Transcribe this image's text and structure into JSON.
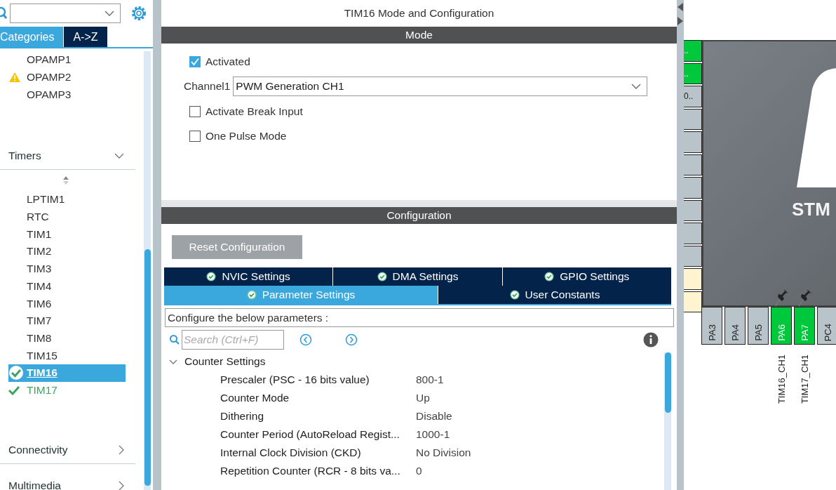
{
  "sidebar": {
    "tabs": [
      {
        "label": "Categories",
        "selected": true
      },
      {
        "label": "A->Z",
        "selected": false
      }
    ],
    "items_above": [
      {
        "label": "OPAMP1",
        "warning": false,
        "configured": false,
        "selected": false
      },
      {
        "label": "OPAMP2",
        "warning": true,
        "configured": false,
        "selected": false
      },
      {
        "label": "OPAMP3",
        "warning": false,
        "configured": false,
        "selected": false
      }
    ],
    "categories": [
      {
        "label": "Timers",
        "expanded": true,
        "items": [
          {
            "label": "LPTIM1",
            "warning": false,
            "configured": false,
            "selected": false
          },
          {
            "label": "RTC",
            "warning": false,
            "configured": false,
            "selected": false
          },
          {
            "label": "TIM1",
            "warning": false,
            "configured": false,
            "selected": false
          },
          {
            "label": "TIM2",
            "warning": false,
            "configured": false,
            "selected": false
          },
          {
            "label": "TIM3",
            "warning": false,
            "configured": false,
            "selected": false
          },
          {
            "label": "TIM4",
            "warning": false,
            "configured": false,
            "selected": false
          },
          {
            "label": "TIM6",
            "warning": false,
            "configured": false,
            "selected": false
          },
          {
            "label": "TIM7",
            "warning": false,
            "configured": false,
            "selected": false
          },
          {
            "label": "TIM8",
            "warning": false,
            "configured": false,
            "selected": false
          },
          {
            "label": "TIM15",
            "warning": false,
            "configured": false,
            "selected": false
          },
          {
            "label": "TIM16",
            "warning": false,
            "configured": true,
            "selected": true
          },
          {
            "label": "TIM17",
            "warning": false,
            "configured": true,
            "selected": false
          }
        ]
      },
      {
        "label": "Connectivity",
        "expanded": false
      },
      {
        "label": "Multimedia",
        "expanded": false
      }
    ]
  },
  "panel": {
    "title": "TIM16 Mode and Configuration",
    "mode": {
      "header": "Mode",
      "fields": [
        {
          "kind": "checkbox",
          "label": "Activated",
          "checked": true
        },
        {
          "kind": "select",
          "label": "Channel1",
          "value": "PWM Generation CH1"
        },
        {
          "kind": "checkbox",
          "label": "Activate Break Input",
          "checked": false
        },
        {
          "kind": "checkbox",
          "label": "One Pulse Mode",
          "checked": false
        }
      ]
    },
    "configuration": {
      "header": "Configuration",
      "reset_button": "Reset Configuration",
      "tab_rows": [
        [
          {
            "label": "NVIC Settings",
            "selected": false
          },
          {
            "label": "DMA Settings",
            "selected": false
          },
          {
            "label": "GPIO Settings",
            "selected": false
          }
        ],
        [
          {
            "label": "Parameter Settings",
            "selected": true
          },
          {
            "label": "User Constants",
            "selected": false
          }
        ]
      ],
      "description": "Configure the below parameters :",
      "search": {
        "placeholder": "Search (Ctrl+F)"
      },
      "groups": [
        {
          "label": "Counter Settings",
          "expanded": true,
          "params": [
            {
              "name": "Prescaler (PSC - 16 bits value)",
              "value": "800-1"
            },
            {
              "name": "Counter Mode",
              "value": "Up"
            },
            {
              "name": "Dithering",
              "value": "Disable"
            },
            {
              "name": "Counter Period (AutoReload Regist...",
              "value": "1000-1"
            },
            {
              "name": "Internal Clock Division (CKD)",
              "value": "No Division"
            },
            {
              "name": "Repetition Counter (RCR - 8 bits va...",
              "value": "0"
            }
          ]
        }
      ]
    }
  },
  "chip": {
    "name": "STM",
    "side_pins": [
      {
        "label": "..",
        "color": "#00c83c"
      },
      {
        "label": "..",
        "color": "#00c83c"
      },
      {
        "label": "0..",
        "color": "#b9c3ca"
      },
      {
        "color": "#b9c3ca"
      },
      {
        "color": "#b9c3ca"
      },
      {
        "color": "#b9c3ca"
      },
      {
        "color": "#b9c3ca"
      },
      {
        "color": "#b9c3ca"
      },
      {
        "color": "#b9c3ca"
      },
      {
        "color": "#b9c3ca"
      },
      {
        "color": "#fff4cf"
      },
      {
        "color": "#fff4cf"
      }
    ],
    "bottom_pins": [
      {
        "label": "PA3",
        "color": "#b9c3ca",
        "pinned": false
      },
      {
        "label": "PA4",
        "color": "#b9c3ca",
        "pinned": false
      },
      {
        "label": "PA5",
        "color": "#b9c3ca",
        "pinned": false
      },
      {
        "label": "PA6",
        "color": "#00c83c",
        "pinned": true,
        "signal": "TIM16_CH1"
      },
      {
        "label": "PA7",
        "color": "#00c83c",
        "pinned": true,
        "signal": "TIM17_CH1"
      },
      {
        "label": "PC4",
        "color": "#b9c3ca",
        "pinned": false
      }
    ]
  }
}
